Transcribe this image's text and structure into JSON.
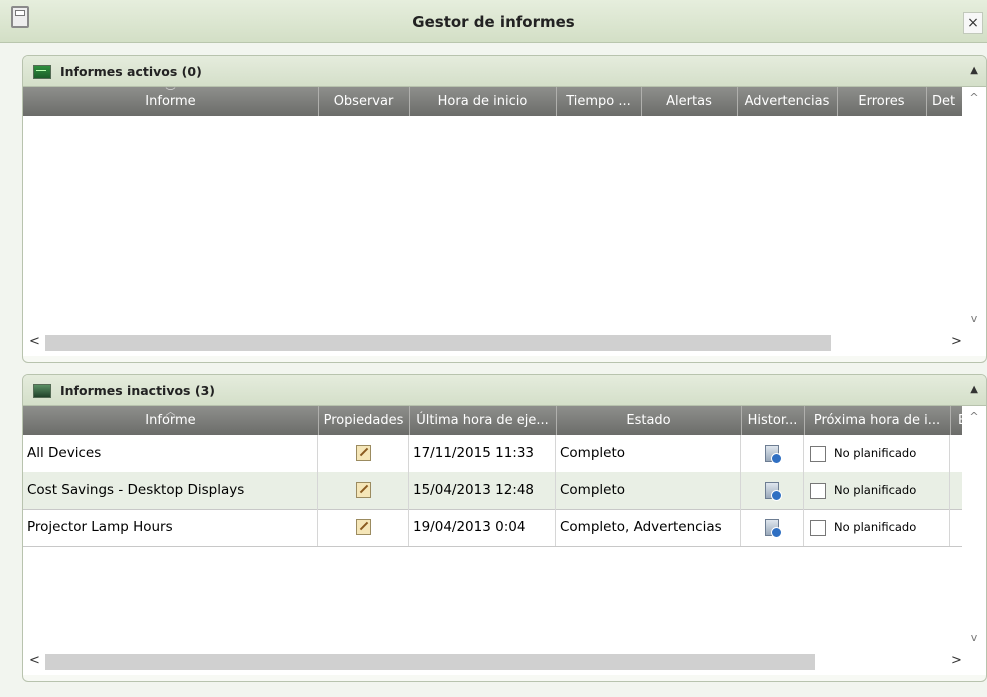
{
  "window": {
    "title": "Gestor de informes",
    "close_label": "×"
  },
  "active_panel": {
    "title": "Informes activos (0)",
    "collapse_label": "▲",
    "columns": [
      "Informe",
      "Observar",
      "Hora de inicio",
      "Tiempo ...",
      "Alertas",
      "Advertencias",
      "Errores",
      "Det"
    ],
    "scroll_left": "<",
    "scroll_right": ">",
    "scroll_up": "^",
    "scroll_down": "v"
  },
  "inactive_panel": {
    "title": "Informes inactivos (3)",
    "collapse_label": "▲",
    "columns": [
      "Informe",
      "Propiedades",
      "Última hora de eje...",
      "Estado",
      "Histor...",
      "Próxima hora de i...",
      "E"
    ],
    "rows": [
      {
        "informe": "All Devices",
        "ultima": "17/11/2015 11:33",
        "estado": "Completo",
        "proxima": "No planificado"
      },
      {
        "informe": "Cost Savings - Desktop Displays",
        "ultima": "15/04/2013 12:48",
        "estado": "Completo",
        "proxima": "No planificado"
      },
      {
        "informe": "Projector Lamp Hours",
        "ultima": "19/04/2013 0:04",
        "estado": "Completo, Advertencias",
        "proxima": "No planificado"
      }
    ],
    "scroll_left": "<",
    "scroll_right": ">",
    "scroll_up": "^",
    "scroll_down": "v"
  }
}
